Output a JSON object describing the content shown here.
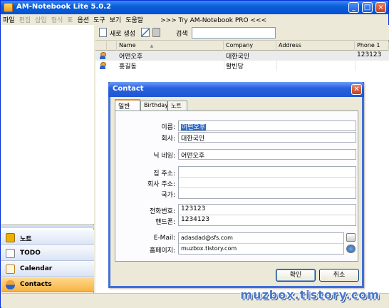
{
  "window": {
    "title": "AM-Notebook Lite  5.0.2",
    "controls": [
      "_",
      "□",
      "×"
    ]
  },
  "menu": {
    "items": [
      {
        "label": "파일",
        "enabled": true
      },
      {
        "label": "편집",
        "enabled": false
      },
      {
        "label": "삽입",
        "enabled": false
      },
      {
        "label": "형식",
        "enabled": false
      },
      {
        "label": "표",
        "enabled": false
      },
      {
        "label": "옵션",
        "enabled": true
      },
      {
        "label": "도구",
        "enabled": true
      },
      {
        "label": "보기",
        "enabled": true
      },
      {
        "label": "도움말",
        "enabled": true
      }
    ],
    "promo": ">>> Try AM-Notebook PRO <<<"
  },
  "sidebar": {
    "items": [
      {
        "label": "노트",
        "icon": "note-icon",
        "color": "#f0b000"
      },
      {
        "label": "TODO",
        "icon": "checkbox-icon",
        "color": "#d04040"
      },
      {
        "label": "Calendar",
        "icon": "calendar-icon",
        "color": "#e08a1e"
      },
      {
        "label": "Contacts",
        "icon": "person-icon",
        "color": "#2b63c9",
        "active": true
      }
    ]
  },
  "toolbar": {
    "new_label": "새로 생성",
    "search_label": "검색",
    "search_value": ""
  },
  "grid": {
    "columns": [
      "Name",
      "Company",
      "Address",
      "Phone 1"
    ],
    "rows": [
      {
        "name": "어떤오후",
        "company": "대한국인",
        "address": "",
        "phone1": "123123",
        "selected": true
      },
      {
        "name": "홍길동",
        "company": "활빈당",
        "address": "",
        "phone1": "",
        "selected": false
      }
    ]
  },
  "dialog": {
    "title": "Contact",
    "tabs": [
      "일반",
      "Birthday",
      "노트"
    ],
    "active_tab": "일반",
    "fields": {
      "name_label": "이름:",
      "name_value": "어떤오후",
      "company_label": "회사:",
      "company_value": "대한국인",
      "nickname_label": "닉 네임:",
      "nickname_value": "어떤오후",
      "home_address_label": "집 주소:",
      "home_address_value": "",
      "work_address_label": "회사 주소:",
      "work_address_value": "",
      "country_label": "국가:",
      "country_value": "",
      "phone_label": "전화번호:",
      "phone_value": "123123",
      "mobile_label": "핸드폰:",
      "mobile_value": "1234123",
      "email_label": "E-Mail:",
      "email_value": "adasdad@sfs.com",
      "homepage_label": "홈페이지:",
      "homepage_value": "muzbox.tistory.com"
    },
    "ok_label": "확인",
    "cancel_label": "취소"
  },
  "watermark": "muzbox.tistory.com",
  "colors": {
    "titlebar": "#0a5fd6",
    "selection": "#316ac5",
    "active_nav": "#f8b340"
  }
}
